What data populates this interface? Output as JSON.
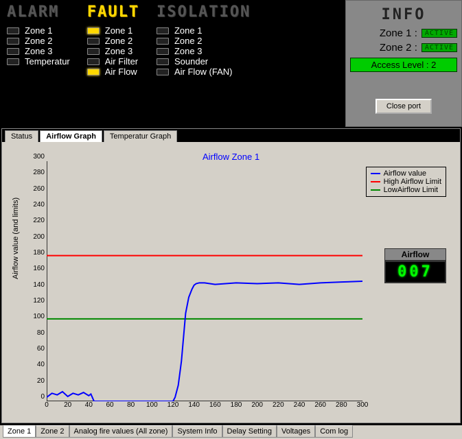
{
  "status_columns": {
    "alarm": {
      "header": "ALARM",
      "items": [
        {
          "label": "Zone 1",
          "on": false
        },
        {
          "label": "Zone 2",
          "on": false
        },
        {
          "label": "Zone 3",
          "on": false
        },
        {
          "label": "Temperatur",
          "on": false
        }
      ]
    },
    "fault": {
      "header": "FAULT",
      "items": [
        {
          "label": "Zone 1",
          "on": true
        },
        {
          "label": "Zone 2",
          "on": false
        },
        {
          "label": "Zone 3",
          "on": false
        },
        {
          "label": "Air Filter",
          "on": false
        },
        {
          "label": "Air Flow",
          "on": true
        }
      ]
    },
    "isolation": {
      "header": "ISOLATION",
      "items": [
        {
          "label": "Zone 1",
          "on": false
        },
        {
          "label": "Zone 2",
          "on": false
        },
        {
          "label": "Zone 3",
          "on": false
        },
        {
          "label": "Sounder",
          "on": false
        },
        {
          "label": "Air Flow (FAN)",
          "on": false
        }
      ]
    }
  },
  "info": {
    "title": "INFO",
    "zone1_label": "Zone 1 :",
    "zone1_status": "ACTIVE",
    "zone2_label": "Zone 2 :",
    "zone2_status": "ACTIVE",
    "access_label": "Access Level : 2",
    "close_btn": "Close port"
  },
  "top_tabs": [
    "Status",
    "Airflow Graph",
    "Temperatur Graph"
  ],
  "top_tab_selected": 1,
  "bottom_tabs": [
    "Zone 1",
    "Zone 2",
    "Analog fire values (All zone)",
    "System Info",
    "Delay Setting",
    "Voltages",
    "Com log"
  ],
  "bottom_tab_selected": 0,
  "airflow_display": {
    "label": "Airflow",
    "value": "007"
  },
  "chart_data": {
    "type": "line",
    "title": "Airflow Zone 1",
    "ylabel": "Airflow value (and limits)",
    "xlabel": "",
    "xlim": [
      0,
      300
    ],
    "ylim": [
      0,
      300
    ],
    "x_ticks": [
      0,
      20,
      40,
      60,
      80,
      100,
      120,
      140,
      160,
      180,
      200,
      220,
      240,
      260,
      280,
      300
    ],
    "y_ticks": [
      0,
      20,
      40,
      60,
      80,
      100,
      120,
      140,
      160,
      180,
      200,
      220,
      240,
      260,
      280,
      300
    ],
    "legend": [
      {
        "name": "Airflow value",
        "color": "#0000ff"
      },
      {
        "name": "High Airflow Limit",
        "color": "#ff0000"
      },
      {
        "name": "LowAirflow Limit",
        "color": "#008800"
      }
    ],
    "hline_high": 182,
    "hline_low": 103,
    "series": [
      {
        "name": "Airflow value",
        "color": "#0000ff",
        "x": [
          0,
          5,
          10,
          15,
          20,
          25,
          30,
          35,
          40,
          42,
          45,
          120,
          122,
          125,
          128,
          130,
          132,
          135,
          138,
          140,
          142,
          145,
          150,
          160,
          180,
          200,
          220,
          240,
          260,
          280,
          300
        ],
        "y": [
          5,
          10,
          8,
          12,
          6,
          10,
          8,
          11,
          7,
          9,
          0,
          0,
          5,
          20,
          50,
          80,
          110,
          130,
          140,
          145,
          147,
          148,
          148,
          146,
          148,
          147,
          148,
          146,
          148,
          149,
          150
        ]
      }
    ]
  }
}
